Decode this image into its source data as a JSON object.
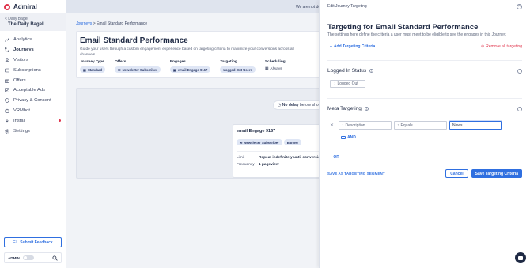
{
  "app": {
    "brand_name": "Admiral"
  },
  "sidebar": {
    "back_label": "< Daily Bagel",
    "site_name": "The Daily Bagel",
    "items": [
      {
        "label": "Analytics",
        "icon": "chart-icon"
      },
      {
        "label": "Journeys",
        "icon": "journey-icon",
        "active": true
      },
      {
        "label": "Visitors",
        "icon": "visitors-icon"
      },
      {
        "label": "Subscriptions",
        "icon": "subscriptions-icon"
      },
      {
        "label": "Offers",
        "icon": "offers-icon"
      },
      {
        "label": "Acceptable Ads",
        "icon": "acceptable-ads-icon"
      },
      {
        "label": "Privacy & Consent",
        "icon": "shield-icon"
      },
      {
        "label": "VRMbot",
        "icon": "bot-icon"
      },
      {
        "label": "Install",
        "icon": "install-icon",
        "alert": true
      },
      {
        "label": "Settings",
        "icon": "gear-icon"
      }
    ],
    "feedback_label": "Submit Feedback",
    "admin_label": "ADMIN"
  },
  "main": {
    "banner": "We are not detecting a tag on your site. Please install the",
    "breadcrumb_root": "Journeys",
    "breadcrumb_sep": ">",
    "breadcrumb_current": "Email Standard Performance",
    "journey": {
      "title": "Email Standard Performance",
      "description": "Guide your users through a custom engagement experience based on targeting criteria to maximize your conversions across all channels.",
      "columns": {
        "journey_type": {
          "header": "Journey Type",
          "value": "Standard"
        },
        "offers": {
          "header": "Offers",
          "value": "Newsletter Subscriber"
        },
        "engages": {
          "header": "Engages",
          "value": "email Engage 9167"
        },
        "targeting": {
          "header": "Targeting",
          "value": "Logged-Out Users"
        },
        "scheduling": {
          "header": "Scheduling",
          "value": "Always"
        }
      }
    },
    "flow": {
      "delay_bold": "No delay",
      "delay_rest": "before showing first",
      "engage": {
        "name": "email Engage 9167",
        "chip_offer": "Newsletter Subscriber",
        "chip_type": "Banner",
        "limit_label": "Limit",
        "limit_value": "Repeat indefinitely until conversion.",
        "frequency_label": "Frequency",
        "frequency_value": "1 pageview"
      }
    }
  },
  "panel": {
    "header": "Edit Journey Targeting",
    "title": "Targeting for Email Standard Performance",
    "subtitle": "The settings here define the criteria a user must meet to be eligible to see the engages in this Journey.",
    "add_criteria": "Add Targeting Criteria",
    "remove_all": "Remove all targeting",
    "logged_in": {
      "heading": "Logged In Status",
      "value": "Logged Out"
    },
    "meta": {
      "heading": "Meta Targeting",
      "field_placeholder": "Description",
      "operator": "Equals",
      "value": "News",
      "and_label": "AND",
      "or_label": "OR"
    },
    "save_segment": "SAVE AS TARGETING SEGMENT",
    "cancel": "Cancel",
    "save": "Save Targeting Criteria"
  },
  "colors": {
    "accent": "#2f6fe0",
    "brand": "#e0344c",
    "text": "#1f2a44"
  }
}
